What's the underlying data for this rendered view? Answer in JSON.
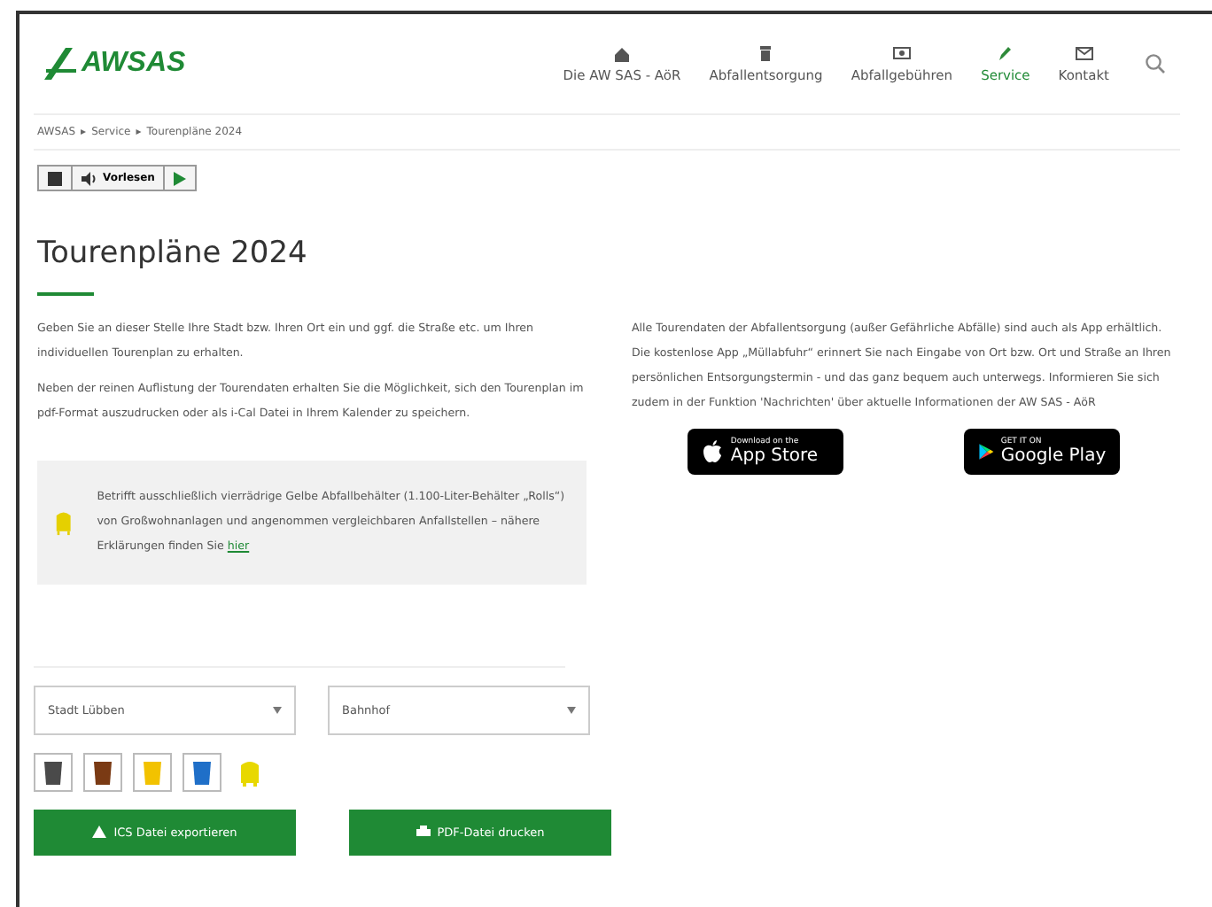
{
  "logo": {
    "text": "AWSAS"
  },
  "nav": [
    {
      "label": "Die AW SAS - AöR",
      "kind": "home",
      "selected": false
    },
    {
      "label": "Abfallentsorgung",
      "kind": "bin",
      "selected": false
    },
    {
      "label": "Abfallgebühren",
      "kind": "money",
      "selected": false
    },
    {
      "label": "Service",
      "kind": "pencil",
      "selected": true
    },
    {
      "label": "Kontakt",
      "kind": "mail",
      "selected": false
    }
  ],
  "breadcrumb": [
    "AWSAS",
    "Service",
    "Tourenpläne 2024"
  ],
  "breadcrumb_separator": "▸",
  "reader": {
    "label": "Vorlesen"
  },
  "title": "Tourenpläne 2024",
  "left_paragraphs": [
    "Geben Sie an dieser Stelle Ihre Stadt bzw. Ihren Ort ein und ggf. die Straße etc. um Ihren individuellen Tourenplan zu erhalten.",
    "Neben der reinen Auflistung der Tourendaten erhalten Sie die Möglichkeit, sich den Tourenplan im pdf-Format auszudrucken oder als i-Cal Datei in Ihrem Kalender zu speichern."
  ],
  "right_paragraph": "Alle Tourendaten der Abfallentsorgung (außer Gefährliche Abfälle) sind auch als App erhältlich. Die kostenlose App „Müllabfuhr“ erinnert Sie nach Eingabe von Ort bzw. Ort und Straße an Ihren persönlichen Entsorgungstermin - und das ganz bequem auch unterwegs. Informieren Sie sich zudem in der Funktion 'Nachrichten' über aktuelle Informationen der AW SAS - AöR",
  "app_badges": [
    {
      "kind": "apple",
      "small": "Download on the",
      "big": "App Store"
    },
    {
      "kind": "google",
      "small": "GET IT ON",
      "big": "Google Play"
    }
  ],
  "notice": {
    "text": "Betrifft ausschließlich vierrädrige Gelbe Abfallbehälter (1.100-Liter-Behälter „Rolls“) von Großwohnanlagen und angenommen vergleichbaren Anfallstellen – nähere Erklärungen finden Sie",
    "link": "hier"
  },
  "selects": [
    {
      "value": "Stadt Lübben"
    },
    {
      "value": "Bahnhof"
    }
  ],
  "bins": [
    {
      "kind": "bin",
      "color": "#4a4a4a"
    },
    {
      "kind": "bin",
      "color": "#7a3a14"
    },
    {
      "kind": "bin",
      "color": "#f2c200"
    },
    {
      "kind": "bin",
      "color": "#1f6fc8"
    },
    {
      "kind": "container",
      "color": "#e8d800"
    }
  ],
  "buttons": [
    {
      "label": "ICS Datei exportieren",
      "kind": "export"
    },
    {
      "label": "PDF-Datei drucken",
      "kind": "print"
    }
  ]
}
